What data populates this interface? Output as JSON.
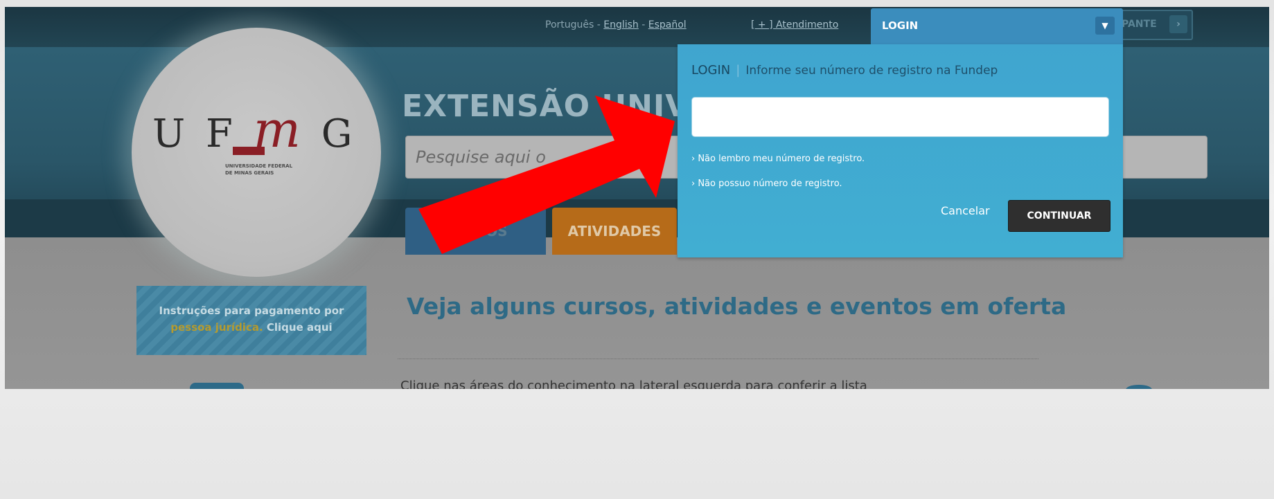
{
  "header": {
    "languages": {
      "pt": "Português",
      "sep1": " - ",
      "en": "English",
      "sep2": " - ",
      "es": "Español"
    },
    "atendimento_link": "[ + ] Atendimento",
    "participante_label": "PANTE",
    "participante_arrow": "›"
  },
  "logo": {
    "u": "U",
    "f": "F",
    "m": "m",
    "g": "G",
    "subtitle": "UNIVERSIDADE FEDERAL\nDE MINAS GERAIS"
  },
  "banner": {
    "title": "EXTENSÃO UNIVE"
  },
  "search": {
    "placeholder": "Pesquise aqui o"
  },
  "nav": {
    "tabs": [
      {
        "label": "CURSOS"
      },
      {
        "label": "ATIVIDADES"
      }
    ]
  },
  "promo": {
    "line1": "Instruções para pagamento por",
    "highlight": "pessoa jurídica.",
    "line2_rest": " Clique aqui"
  },
  "main": {
    "heading": "Veja alguns cursos, atividades e eventos em oferta",
    "intro": "Clique nas áreas do conhecimento na lateral esquerda para conferir a lista"
  },
  "login": {
    "header_label": "LOGIN",
    "chevron": "▼",
    "panel_title": "LOGIN",
    "panel_hint": "Informe seu número de registro na Fundep",
    "registration_value": "",
    "link_forgot": "› Não lembro meu número de registro.",
    "link_no_number": "› Não possuo número de registro.",
    "cancel_label": "Cancelar",
    "continue_label": "CONTINUAR"
  },
  "colors": {
    "login_panel": "#41aed2",
    "login_header": "#3b8dbd",
    "annotation_arrow": "#ff0000",
    "continue_button": "#2f2f2f"
  }
}
